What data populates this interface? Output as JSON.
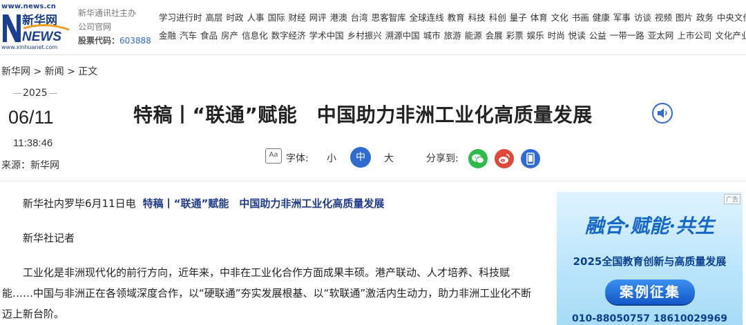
{
  "header": {
    "logo_url_text": "www.news.cn",
    "logo_name": "新华网",
    "logo_news": "NEWS",
    "logo_url_bottom": "www.xinhuanet.com",
    "org_line1": "新华通讯社主办",
    "org_line2": "公司官网",
    "stock_label": "股票代码：",
    "stock_code": "603888",
    "nav_row1": [
      "学习进行时",
      "高层",
      "时政",
      "人事",
      "国际",
      "财经",
      "网评",
      "港澳",
      "台湾",
      "思客智库",
      "全球连线",
      "教育",
      "科技",
      "科创",
      "量子",
      "体育",
      "文化",
      "书画",
      "健康",
      "军事",
      "访谈",
      "视频",
      "图片",
      "政务",
      "中央文件"
    ],
    "nav_row2": [
      "金融",
      "汽车",
      "食品",
      "房产",
      "信息化",
      "数字经济",
      "学术中国",
      "乡村振兴",
      "溯源中国",
      "城市",
      "旅游",
      "能源",
      "会展",
      "彩票",
      "娱乐",
      "时尚",
      "悦读",
      "公益",
      "一带一路",
      "亚太网",
      "上市公司",
      "文化产业"
    ]
  },
  "breadcrumb": [
    "新华网",
    ">",
    "新闻",
    ">",
    "正文"
  ],
  "meta": {
    "year": "2025",
    "month_day": "06/11",
    "time": "11:38:46",
    "source": "来源：新华网"
  },
  "article": {
    "title": "特稿丨“联通”赋能　中国助力非洲工业化高质量发展",
    "dateline": "新华社内罗毕6月11日电",
    "headline_inline": "特稿丨“联通”赋能　中国助力非洲工业化高质量发展",
    "byline": "新华社记者",
    "para1": "工业化是非洲现代化的前行方向，近年来，中非在工业化合作方面成果丰硕。港产联动、人才培养、科技赋能……中国与非洲正在各领域深度合作，以“硬联通”夯实发展根基、以“软联通”激活内生动力，助力非洲工业化不断迈上新台阶。"
  },
  "toolbar": {
    "font_icon": "Aa",
    "font_label": "字体:",
    "font_small": "小",
    "font_medium": "中",
    "font_large": "大",
    "share_label": "分享到:"
  },
  "ad": {
    "tag": "广告",
    "slogan": "融合·赋能·共生",
    "subtitle": "2025全国教育创新与高质量发展",
    "button": "案例征集",
    "phone": "010-88050757  18610029969"
  },
  "icons": {
    "audio": "speaker-icon",
    "wechat": "wechat-icon",
    "weibo": "weibo-icon",
    "mobile": "mobile-icon"
  },
  "colors": {
    "accent_blue": "#2f6bd1",
    "headline_navy": "#1e3a8a",
    "wechat_green": "#2dbb4a",
    "weibo_red": "#e0493a"
  }
}
